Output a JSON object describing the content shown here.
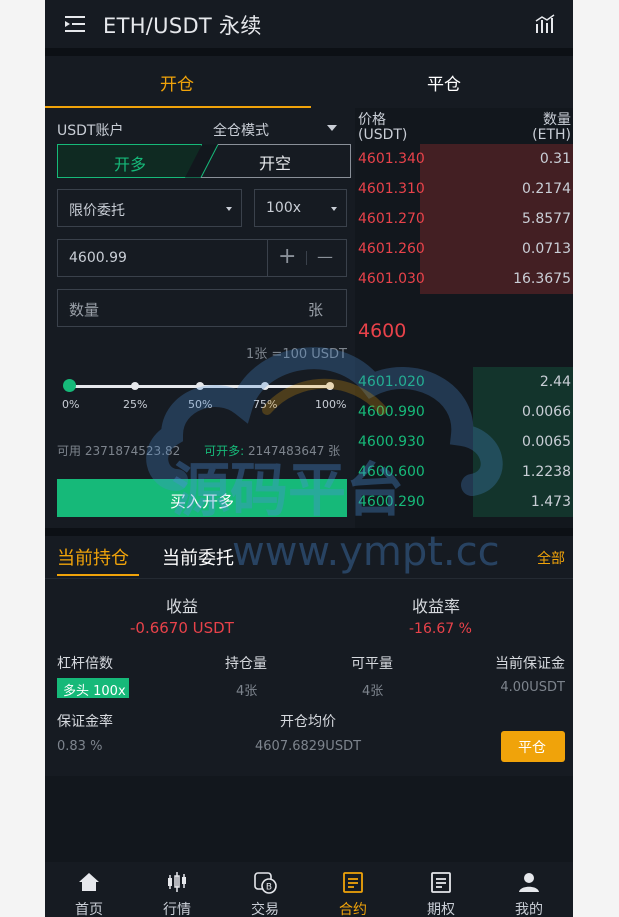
{
  "header": {
    "title": "ETH/USDT 永续",
    "menu_icon": "menu-list-icon",
    "chart_icon": "bar-chart-icon"
  },
  "tabs": {
    "open": "开仓",
    "close": "平仓"
  },
  "order_form": {
    "account": "USDT账户",
    "mode": "全仓模式",
    "long_label": "开多",
    "short_label": "开空",
    "order_type": "限价委托",
    "leverage": "100x",
    "price": "4600.99",
    "plus_glyph": "+",
    "minus_glyph": "—",
    "quantity_placeholder": "数量",
    "quantity_unit": "张",
    "contract_info": "1张 =100 USDT",
    "slider_marks": [
      "0%",
      "25%",
      "50%",
      "75%",
      "100%"
    ],
    "slider_value_pct": 0,
    "available_label": "可用",
    "available_value": "2371874523.82",
    "can_open_label": "可开多:",
    "can_open_value": "2147483647 张",
    "buy_label": "买入开多"
  },
  "order_book": {
    "price_header": "价格\n(USDT)",
    "qty_header": "数量\n(ETH)",
    "asks": [
      {
        "price": "4601.340",
        "qty": "0.31",
        "depth": 0.7
      },
      {
        "price": "4601.310",
        "qty": "0.2174",
        "depth": 0.7
      },
      {
        "price": "4601.270",
        "qty": "5.8577",
        "depth": 0.7
      },
      {
        "price": "4601.260",
        "qty": "0.0713",
        "depth": 0.7
      },
      {
        "price": "4601.030",
        "qty": "16.3675",
        "depth": 0.7
      }
    ],
    "last_price": "4600",
    "bids": [
      {
        "price": "4601.020",
        "qty": "2.44",
        "depth": 0.46
      },
      {
        "price": "4600.990",
        "qty": "0.0066",
        "depth": 0.46
      },
      {
        "price": "4600.930",
        "qty": "0.0065",
        "depth": 0.46
      },
      {
        "price": "4600.600",
        "qty": "1.2238",
        "depth": 0.46
      },
      {
        "price": "4600.290",
        "qty": "1.473",
        "depth": 0.46
      }
    ]
  },
  "positions": {
    "tab_current": "当前持仓",
    "tab_orders": "当前委托",
    "all_label": "全部",
    "profit_label": "收益",
    "profit_value": "-0.6670 USDT",
    "rate_label": "收益率",
    "rate_value": "-16.67 %",
    "leverage_label": "杠杆倍数",
    "leverage_badge": "多头 100x",
    "holding_label": "持仓量",
    "holding_value": "4张",
    "closable_label": "可平量",
    "closable_value": "4张",
    "margin_label": "当前保证金",
    "margin_value": "4.00USDT",
    "margin_rate_label": "保证金率",
    "margin_rate_value": "0.83 %",
    "avg_price_label": "开仓均价",
    "avg_price_value": "4607.6829USDT",
    "close_button": "平仓"
  },
  "bottom_nav": [
    {
      "label": "首页",
      "icon": "home-icon"
    },
    {
      "label": "行情",
      "icon": "candlestick-icon"
    },
    {
      "label": "交易",
      "icon": "exchange-coin-icon"
    },
    {
      "label": "合约",
      "icon": "contract-document-icon",
      "active": true
    },
    {
      "label": "期权",
      "icon": "options-document-icon"
    },
    {
      "label": "我的",
      "icon": "user-icon"
    }
  ],
  "watermark": {
    "cn": "源码平台",
    "url": "www.ympt.cc"
  },
  "colors": {
    "bg": "#12171d",
    "panel": "#161b22",
    "accent": "#f0a30a",
    "green": "#16b979",
    "red": "#e8424a"
  }
}
